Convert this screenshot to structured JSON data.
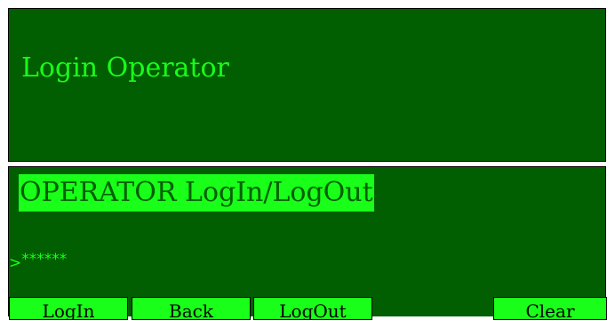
{
  "header": {
    "title": "Login Operator"
  },
  "main": {
    "banner": "OPERATOR LogIn/LogOut",
    "prompt_symbol": ">",
    "input_value": "******"
  },
  "buttons": {
    "login": "LogIn",
    "back": "Back",
    "logout": "LogOut",
    "clear": "Clear"
  },
  "colors": {
    "panel_bg": "#015f01",
    "accent": "#19ff19",
    "border": "#000000"
  }
}
